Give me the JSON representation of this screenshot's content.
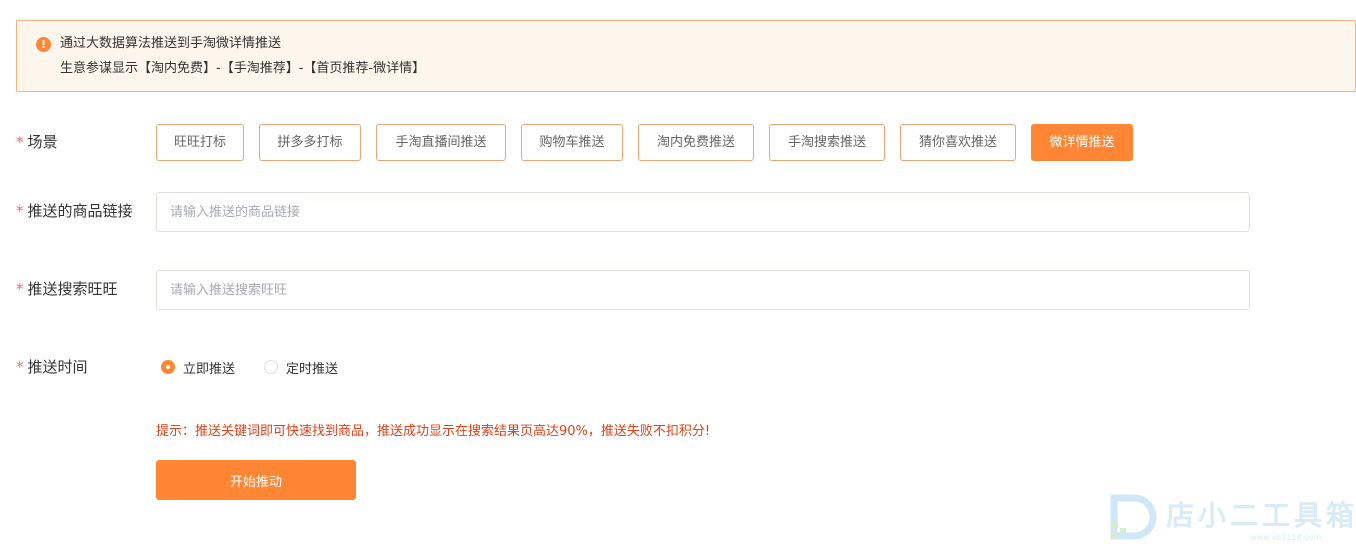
{
  "notice": {
    "icon": "exclamation-circle-icon",
    "icon_glyph": "!",
    "line1": "通过大数据算法推送到手淘微详情推送",
    "line2": "生意参谋显示【淘内免费】-【手淘推荐】-【首页推荐-微详情】"
  },
  "form": {
    "required_mark": "*",
    "scene": {
      "label": "场景",
      "options": [
        "旺旺打标",
        "拼多多打标",
        "手淘直播间推送",
        "购物车推送",
        "淘内免费推送",
        "手淘搜索推送",
        "猜你喜欢推送",
        "微详情推送"
      ],
      "selected": "微详情推送"
    },
    "product_link": {
      "label": "推送的商品链接",
      "placeholder": "请输入推送的商品链接",
      "value": ""
    },
    "search_wangwang": {
      "label": "推送搜索旺旺",
      "placeholder": "请输入推送搜索旺旺",
      "value": ""
    },
    "push_time": {
      "label": "推送时间",
      "options": [
        "立即推送",
        "定时推送"
      ],
      "selected": "立即推送"
    }
  },
  "tip": "提示：推送关键词即可快速找到商品，推送成功显示在搜索结果页高达90%，推送失败不扣积分!",
  "start_button": "开始推动",
  "watermark": {
    "text": "店小二工具箱",
    "url": "www.xd1118.com"
  },
  "colors": {
    "accent": "#ff8634",
    "notice_bg": "#fdf6ec",
    "notice_border": "#f3b37a",
    "required": "#f56c6c",
    "tip": "#d9441b"
  }
}
